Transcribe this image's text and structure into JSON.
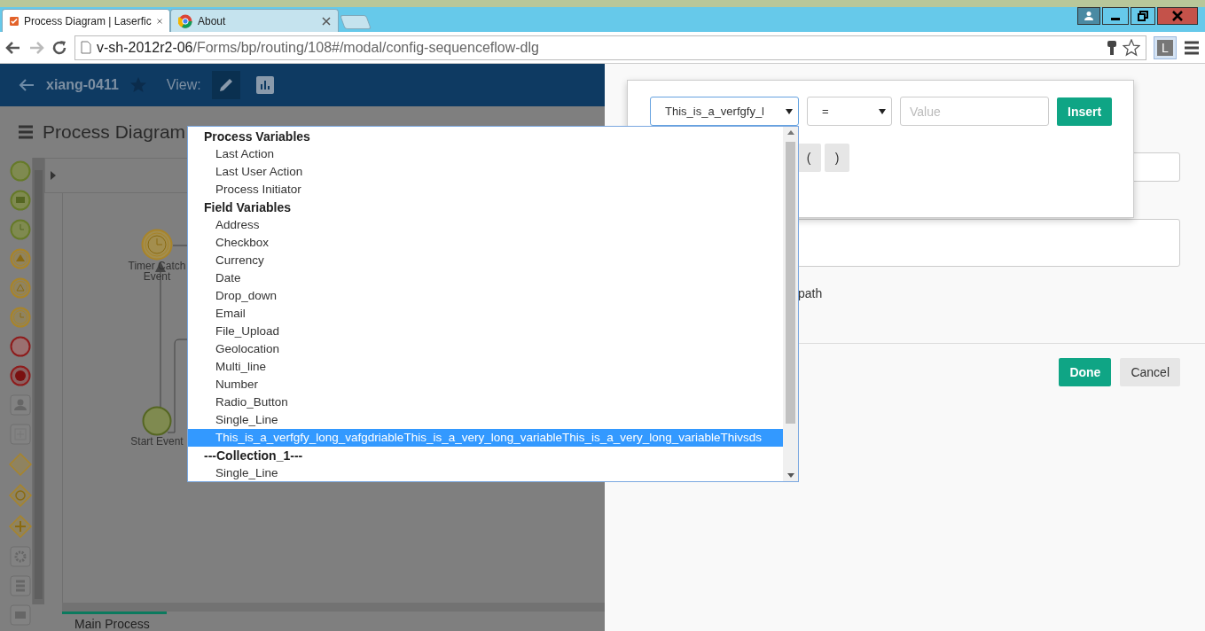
{
  "browser": {
    "tabs": [
      {
        "title": "Process Diagram | Laserfic",
        "kind": "app",
        "selected": true
      },
      {
        "title": "About",
        "kind": "chrome",
        "selected": false
      }
    ],
    "address": {
      "host": "v-sh-2012r2-06",
      "path": "/Forms/bp/routing/108#/modal/config-sequenceflow-dlg"
    },
    "profile_badge": "L"
  },
  "app_header": {
    "process_name": "xiang-0411",
    "view_label": "View:"
  },
  "page_title": "Process Diagram",
  "diagram": {
    "nodes": [
      {
        "label": "Timer Catch Event",
        "kind": "timer"
      },
      {
        "label": "Start Event",
        "kind": "start"
      }
    ],
    "tabs": [
      {
        "label": "Main Process",
        "selected": true
      }
    ]
  },
  "dialog": {
    "path_text": "path",
    "buttons": [
      {
        "label": "Done",
        "kind": "primary"
      },
      {
        "label": "Cancel",
        "kind": "secondary"
      }
    ]
  },
  "condition_popover": {
    "variable_select": "This_is_a_verfgfy_l",
    "operator_select": "=",
    "value_placeholder": "Value",
    "insert_button": "Insert",
    "paren_buttons": [
      "(",
      ")"
    ]
  },
  "variable_dropdown": {
    "groups": [
      {
        "label": "Process Variables",
        "items": [
          {
            "label": "Last Action",
            "selected": false
          },
          {
            "label": "Last User Action",
            "selected": false
          },
          {
            "label": "Process Initiator",
            "selected": false
          }
        ]
      },
      {
        "label": "Field Variables",
        "items": [
          {
            "label": "Address",
            "selected": false
          },
          {
            "label": "Checkbox",
            "selected": false
          },
          {
            "label": "Currency",
            "selected": false
          },
          {
            "label": "Date",
            "selected": false
          },
          {
            "label": "Drop_down",
            "selected": false
          },
          {
            "label": "Email",
            "selected": false
          },
          {
            "label": "File_Upload",
            "selected": false
          },
          {
            "label": "Geolocation",
            "selected": false
          },
          {
            "label": "Multi_line",
            "selected": false
          },
          {
            "label": "Number",
            "selected": false
          },
          {
            "label": "Radio_Button",
            "selected": false
          },
          {
            "label": "Single_Line",
            "selected": false
          },
          {
            "label": "This_is_a_verfgfy_long_vafgdriableThis_is_a_very_long_variableThis_is_a_very_long_variableThivsds",
            "selected": true
          }
        ]
      },
      {
        "label": "---Collection_1---",
        "items": [
          {
            "label": "Single_Line",
            "selected": false
          }
        ]
      }
    ]
  }
}
